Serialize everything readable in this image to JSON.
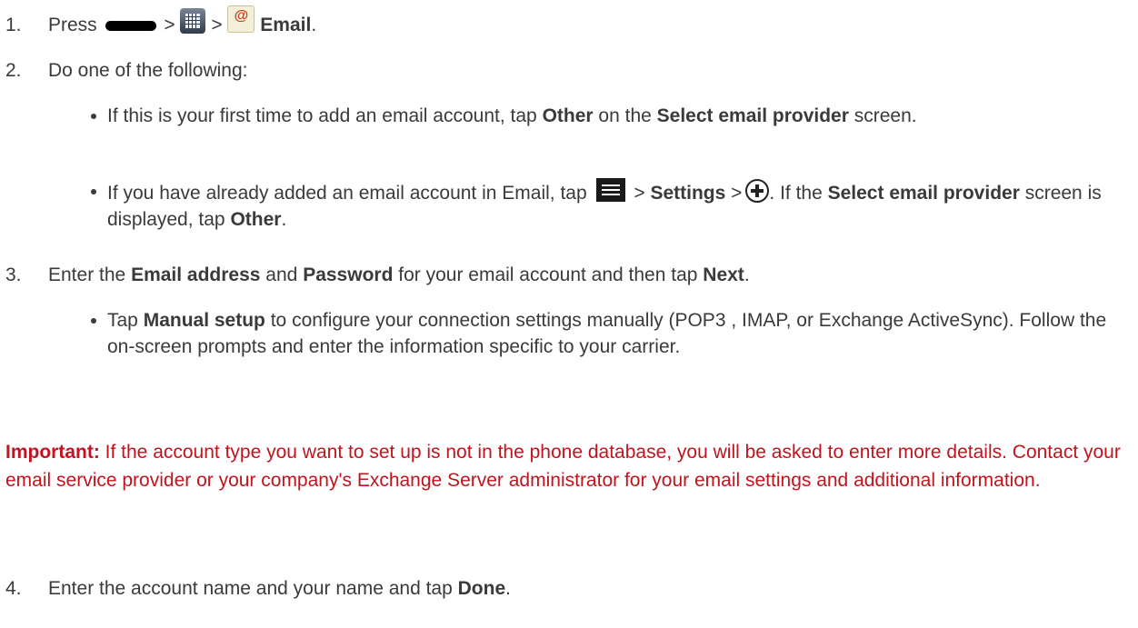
{
  "steps": {
    "s1": {
      "num": "1.",
      "t1": "Press",
      "gt1": ">",
      "gt2": ">",
      "email": "Email",
      "period": "."
    },
    "s2": {
      "num": "2.",
      "text": "Do one of the following:"
    },
    "s3": {
      "num": "3.",
      "t1": "Enter the ",
      "b1": "Email address",
      "t2": " and ",
      "b2": "Password",
      "t3": " for your email account and then tap ",
      "b3": "Next",
      "t4": "."
    },
    "s4": {
      "num": "4.",
      "t1": "Enter the account name and your name and tap ",
      "b1": "Done",
      "t2": "."
    }
  },
  "bullets": {
    "b1": {
      "t1": "If this is your first time to add an email account, tap ",
      "b1": "Other",
      "t2": " on the ",
      "b2": "Select email provider",
      "t3": " screen."
    },
    "b2": {
      "t1": "If you have already added an email account in Email, tap",
      "gt1": ">",
      "b1": "Settings",
      "gt2": ">",
      "t2": ". If the ",
      "b2": "Select email provider",
      "t3": " screen is displayed, tap ",
      "b3": "Other",
      "t4": "."
    },
    "b3": {
      "t1": "Tap ",
      "b1": "Manual setup",
      "t2": " to configure your connection settings manually (POP3 , IMAP, or Exchange ActiveSync). Follow the on-screen prompts and enter the information specific to your carrier."
    }
  },
  "important": {
    "label": "Important:",
    "text": "  If the account type you want to set up is not in the phone database, you will be asked to enter more details. Contact your email service provider or your company's Exchange Server administrator for your email settings and additional information."
  },
  "icons": {
    "home_key": "home-key-icon",
    "apps": "apps-grid-icon",
    "email": "email-app-icon",
    "menu": "menu-icon",
    "add": "add-circle-icon"
  },
  "colors": {
    "body_text": "#3a3a3a",
    "important_text": "#c0141e"
  }
}
